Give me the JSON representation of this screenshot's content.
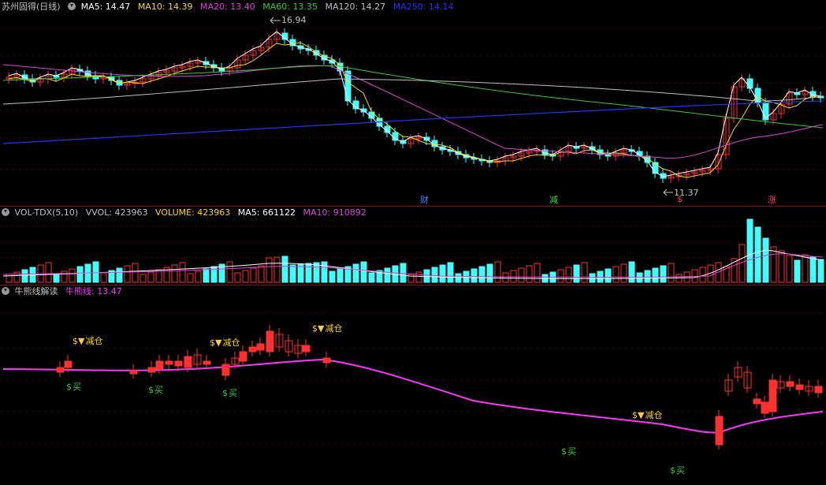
{
  "main": {
    "title": "苏州固得(日线)",
    "ma": [
      {
        "label": "MA5: 14.47",
        "color": "#ffffff"
      },
      {
        "label": "MA10: 14.39",
        "color": "#ffd700"
      },
      {
        "label": "MA20: 13.40",
        "color": "#e040e0"
      },
      {
        "label": "MA60: 13.35",
        "color": "#33cc33"
      },
      {
        "label": "MA120: 14.27",
        "color": "#c0c0c0"
      },
      {
        "label": "MA250: 14.14",
        "color": "#2233ff"
      }
    ],
    "high_label": "16.94",
    "low_label": "11.37",
    "events": [
      "财",
      "减",
      "$",
      "涨"
    ]
  },
  "volume": {
    "title": "VOL-TDX(5,10)",
    "items": [
      {
        "label": "VVOL: 423963",
        "color": "#c0c0c0"
      },
      {
        "label": "VOLUME: 423963",
        "color": "#ffd700"
      },
      {
        "label": "MA5: 661122",
        "color": "#ffffff"
      },
      {
        "label": "MA10: 910892",
        "color": "#e040e0"
      }
    ]
  },
  "indicator": {
    "title": "牛熊线解读",
    "line_label": "牛熊线: 13.47",
    "reduce_label": "减仓",
    "buy_label": "买"
  },
  "colors": {
    "up": "#ff3030",
    "down": "#40ffff",
    "grid": "#7a1010",
    "bullbear": "#ff33ff"
  }
}
